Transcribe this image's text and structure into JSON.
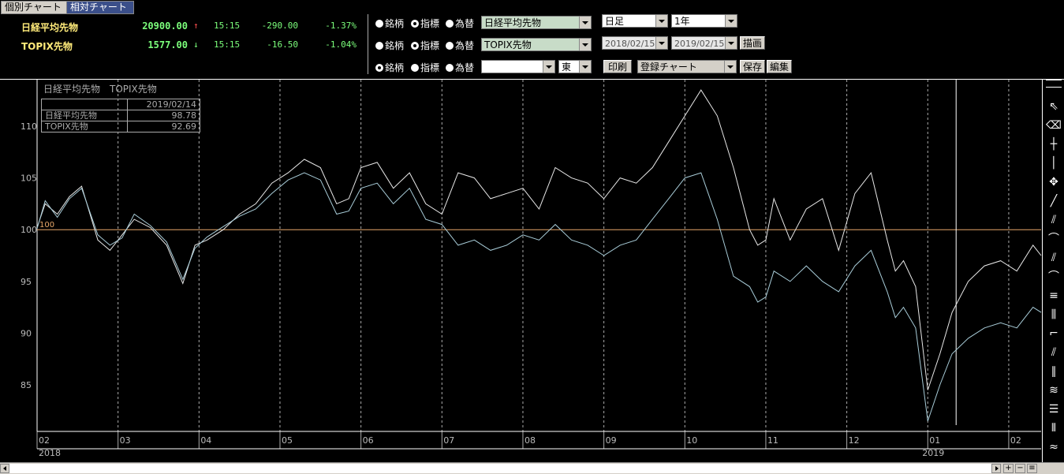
{
  "tabs": [
    "個別チャート",
    "相対チャート"
  ],
  "quotes": [
    {
      "name": "日経平均先物",
      "price": "20900.00",
      "arrow": "↑",
      "time": "15:15",
      "change": "-290.00",
      "pct": "-1.37%"
    },
    {
      "name": "TOPIX先物",
      "price": "1577.00",
      "arrow": "↓",
      "time": "15:15",
      "change": "-16.50",
      "pct": "-1.04%"
    }
  ],
  "controls": {
    "radio_labels": [
      "銘柄",
      "指標",
      "為替"
    ],
    "row1_select": "日経平均先物",
    "row2_select": "TOPIX先物",
    "row3_select": "",
    "exchange": "東",
    "period": "日足",
    "range": "1年",
    "date_from": "2018/02/15",
    "date_to": "2019/02/15",
    "draw_button": "描画",
    "print_button": "印刷",
    "saved_chart": "登録チャート",
    "save_button": "保存",
    "edit_button": "編集"
  },
  "legend": {
    "header": "日経平均先物　TOPIX先物",
    "date": "2019/02/14",
    "rows": [
      {
        "name": "日経平均先物",
        "value": "98.78"
      },
      {
        "name": "TOPIX先物",
        "value": "92.69"
      }
    ]
  },
  "chart_data": {
    "type": "line",
    "baseline": 100,
    "baseline_label": "100",
    "yticks": [
      "110",
      "105",
      "100",
      "95",
      "90",
      "85"
    ],
    "ylim": [
      80.5,
      114.5
    ],
    "xticks": [
      "02",
      "03",
      "04",
      "05",
      "06",
      "07",
      "08",
      "09",
      "10",
      "11",
      "12",
      "01",
      "02"
    ],
    "year_labels": [
      "2018",
      "2019"
    ],
    "months_span": 12.4,
    "cursor_date": "2019/02/14",
    "series": [
      {
        "name": "日経平均先物",
        "color": "#e8e8e8",
        "t": [
          0,
          0.1,
          0.25,
          0.4,
          0.55,
          0.75,
          0.9,
          1.05,
          1.2,
          1.4,
          1.6,
          1.8,
          1.95,
          2.1,
          2.3,
          2.5,
          2.7,
          2.9,
          3.1,
          3.3,
          3.5,
          3.7,
          3.85,
          4.0,
          4.2,
          4.4,
          4.6,
          4.8,
          5.0,
          5.2,
          5.4,
          5.6,
          5.8,
          6.0,
          6.2,
          6.4,
          6.6,
          6.8,
          7.0,
          7.2,
          7.4,
          7.6,
          7.8,
          8.0,
          8.2,
          8.4,
          8.6,
          8.8,
          8.9,
          9.0,
          9.1,
          9.3,
          9.5,
          9.7,
          9.9,
          10.1,
          10.3,
          10.5,
          10.6,
          10.7,
          10.85,
          11.0,
          11.15,
          11.3,
          11.5,
          11.7,
          11.9,
          12.1,
          12.3,
          12.4
        ],
        "v": [
          100.2,
          102.5,
          101.5,
          103.2,
          104.2,
          99,
          98,
          99.5,
          101,
          100.2,
          98.5,
          94.8,
          98.5,
          99,
          100,
          101.5,
          102.5,
          104.5,
          105.5,
          106.8,
          106,
          102.5,
          103,
          106,
          106.5,
          104,
          105.5,
          102.5,
          101.5,
          105.5,
          105,
          103,
          103.5,
          104,
          102,
          106,
          105,
          104.5,
          103,
          105,
          104.5,
          106,
          108.5,
          111,
          113.5,
          111,
          106,
          100,
          98.5,
          99,
          103,
          99,
          102,
          103,
          98,
          103.5,
          105.5,
          99,
          96,
          97,
          94.5,
          84.5,
          88,
          92,
          95,
          96.5,
          97,
          96,
          98.5,
          97.5
        ]
      },
      {
        "name": "TOPIX先物",
        "color": "#a8ccd8",
        "t": [
          0,
          0.1,
          0.25,
          0.4,
          0.55,
          0.75,
          0.9,
          1.05,
          1.2,
          1.4,
          1.6,
          1.8,
          1.95,
          2.1,
          2.3,
          2.5,
          2.7,
          2.9,
          3.1,
          3.3,
          3.5,
          3.7,
          3.85,
          4.0,
          4.2,
          4.4,
          4.6,
          4.8,
          5.0,
          5.2,
          5.4,
          5.6,
          5.8,
          6.0,
          6.2,
          6.4,
          6.6,
          6.8,
          7.0,
          7.2,
          7.4,
          7.6,
          7.8,
          8.0,
          8.2,
          8.4,
          8.6,
          8.8,
          8.9,
          9.0,
          9.1,
          9.3,
          9.5,
          9.7,
          9.9,
          10.1,
          10.3,
          10.5,
          10.6,
          10.7,
          10.85,
          11.0,
          11.15,
          11.3,
          11.5,
          11.7,
          11.9,
          12.1,
          12.3,
          12.4
        ],
        "v": [
          100.1,
          102.8,
          101.2,
          103,
          104,
          99.5,
          98.5,
          99.2,
          101.5,
          100.4,
          98.8,
          95.2,
          98.2,
          99.3,
          100.3,
          101.3,
          102,
          103.5,
          104.8,
          105.5,
          104.8,
          101.5,
          101.8,
          104,
          104.5,
          102.5,
          104,
          101,
          100.5,
          98.5,
          99,
          98,
          98.5,
          99.5,
          99,
          100.5,
          99,
          98.5,
          97.5,
          98.5,
          99,
          101,
          103,
          105,
          105.5,
          101,
          95.5,
          94.5,
          93,
          93.5,
          96,
          95,
          96.5,
          95,
          94,
          96.5,
          98,
          94,
          91.5,
          92.5,
          90.5,
          81.5,
          85,
          88,
          89.5,
          90.5,
          91,
          90.5,
          92.5,
          92
        ]
      }
    ]
  },
  "tools": [
    "pointer-icon",
    "eraser-icon",
    "hline-icon",
    "vline-icon",
    "cross-icon",
    "trendline-icon",
    "fan-icon",
    "fan-arc-icon",
    "fib-fan-icon",
    "fib-arc-icon",
    "channel-icon",
    "fib-channel-icon",
    "step-line-icon",
    "gann-icon",
    "parallel-icon",
    "three-point-icon",
    "segments-icon",
    "vertical-lines-icon",
    "zigzag-icon"
  ],
  "tool_glyphs": [
    "⇖",
    "⌫",
    "┼",
    "│",
    "✥",
    "╱",
    "⫽",
    "⌒",
    "⫽",
    "⌒",
    "≡",
    "⫼",
    "⌐",
    "⫽",
    "∥",
    "≋",
    "☰",
    "⦀",
    "≈"
  ],
  "scrollbar": {
    "plus": "+",
    "minus": "−"
  }
}
